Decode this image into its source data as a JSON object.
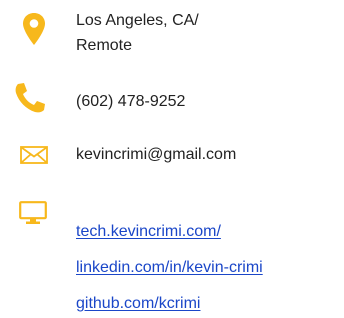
{
  "contact": {
    "location": {
      "icon": "map-pin-icon",
      "line1": "Los Angeles, CA/",
      "line2": "Remote"
    },
    "phone": {
      "icon": "phone-icon",
      "number": "(602) 478-9252"
    },
    "email": {
      "icon": "envelope-icon",
      "address": "kevincrimi@gmail.com"
    },
    "web": {
      "icon": "monitor-icon",
      "links": [
        "tech.kevincrimi.com/",
        "linkedin.com/in/kevin-crimi",
        "github.com/kcrimi"
      ]
    }
  },
  "colors": {
    "icon": "#f7b81c",
    "link": "#1a46c8",
    "text": "#222222"
  }
}
